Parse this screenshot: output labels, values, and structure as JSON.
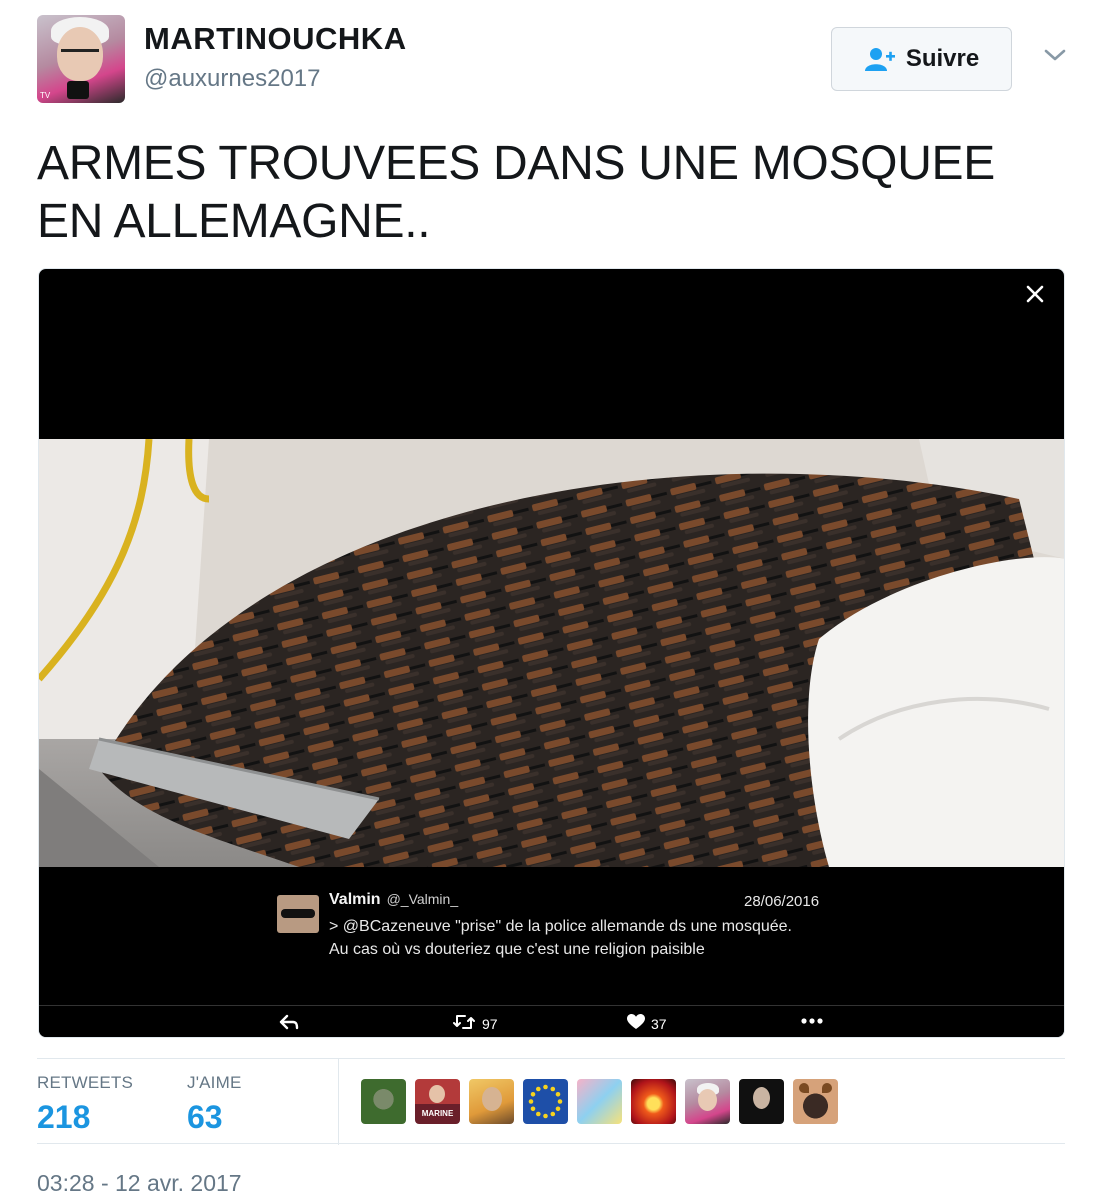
{
  "user": {
    "display_name": "MARTINOUCHKA",
    "handle": "@auxurnes2017",
    "avatar_tv_label": "TV"
  },
  "follow": {
    "label": "Suivre",
    "icon": "add-user-icon"
  },
  "menu": {
    "icon": "chevron-down-icon"
  },
  "tweet": {
    "text_line1": "ARMES TROUVEES DANS UNE MOSQUEE",
    "text_line2": "EN ALLEMAGNE.."
  },
  "media": {
    "close_icon": "close-icon",
    "embedded_tweet": {
      "name": "Valmin",
      "handle": "@_Valmin_",
      "date": "28/06/2016",
      "text": "> @BCazeneuve \"prise\" de la police allemande ds une mosquée. Au cas où vs douteriez que c'est une religion paisible",
      "retweets": "97",
      "likes": "37",
      "icons": [
        "reply-icon",
        "retweet-icon",
        "heart-icon",
        "more-icon"
      ]
    }
  },
  "stats": {
    "retweets_label": "RETWEETS",
    "retweets_value": "218",
    "likes_label": "J'AIME",
    "likes_value": "63",
    "liker_badge_text": "MARINE"
  },
  "timestamp": "03:28 - 12 avr. 2017",
  "colors": {
    "accent": "#1b95e0",
    "secondary_text": "#657786",
    "border": "#e1e8ed"
  }
}
